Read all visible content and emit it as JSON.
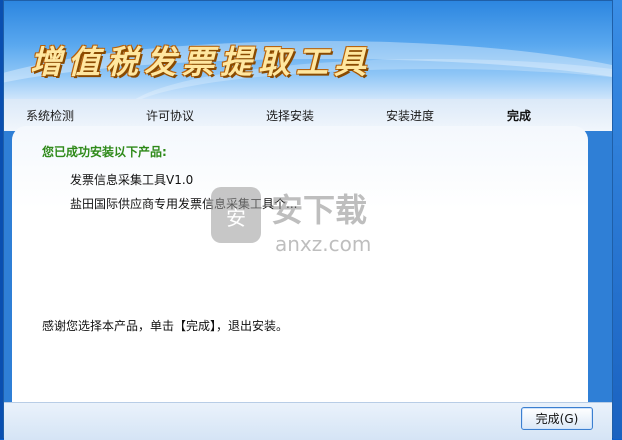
{
  "app_title": "增值税发票提取工具",
  "steps": {
    "system_check": "系统检测",
    "license": "许可协议",
    "select_install": "选择安装",
    "progress": "安装进度",
    "finish": "完成"
  },
  "content": {
    "success_heading": "您已成功安装以下产品:",
    "products": [
      "发票信息采集工具V1.0",
      "盐田国际供应商专用发票信息采集工具个..."
    ],
    "thanks_message": "感谢您选择本产品，单击【完成】，退出安装。"
  },
  "watermark": {
    "brand_cn": "安下载",
    "brand_domain": "anxz.com"
  },
  "buttons": {
    "finish_label": "完成(G)"
  },
  "colors": {
    "success_green": "#2f8a1a",
    "title_gold": "#ffe7a0"
  }
}
